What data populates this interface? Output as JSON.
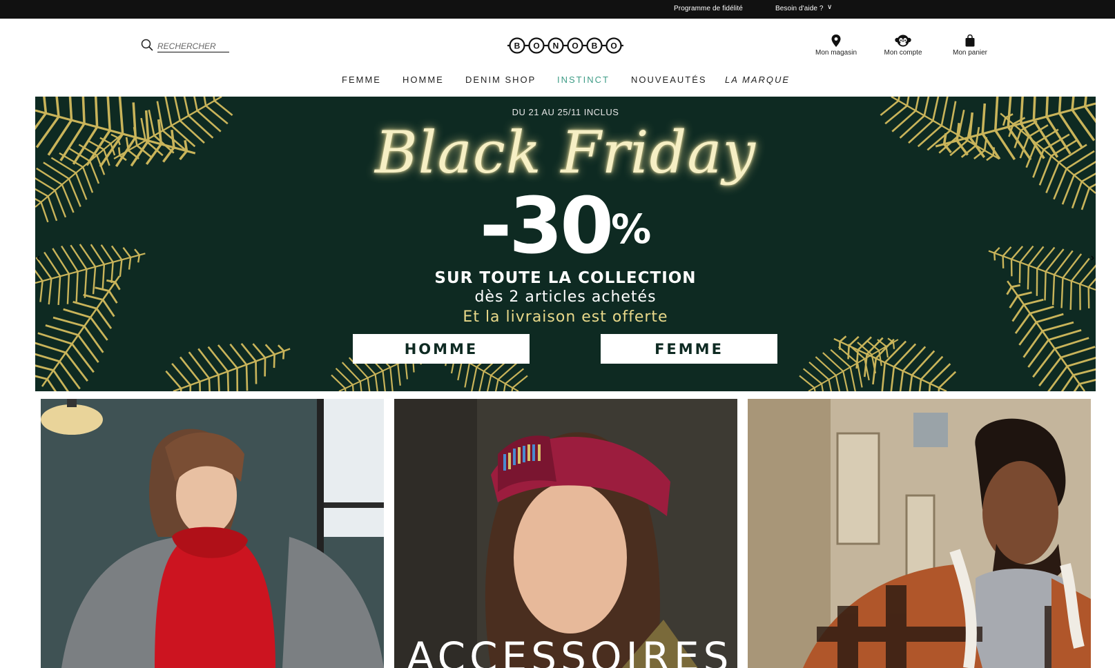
{
  "topbar": {
    "loyalty": "Programme de fidélité",
    "help": "Besoin d'aide ?"
  },
  "search": {
    "placeholder": "RECHERCHER"
  },
  "logo": {
    "letters": [
      "B",
      "O",
      "N",
      "O",
      "B",
      "O"
    ]
  },
  "header_icons": {
    "store": {
      "label": "Mon magasin",
      "icon": "location-pin-icon"
    },
    "account": {
      "label": "Mon compte",
      "icon": "monkey-icon"
    },
    "cart": {
      "label": "Mon panier",
      "icon": "shopping-bag-icon"
    }
  },
  "nav": {
    "items": [
      "FEMME",
      "HOMME",
      "DENIM SHOP",
      "INSTINCT",
      "NOUVEAUTÉS",
      "LA MARQUE"
    ]
  },
  "hero": {
    "dates": "DU 21 AU 25/11 INCLUS",
    "title": "Black Friday",
    "discount": "-30",
    "percent": "%",
    "line1": "SUR TOUTE LA COLLECTION",
    "line2": "dès 2 articles achetés",
    "line3": "Et la livraison est offerte",
    "cta_homme": "HOMME",
    "cta_femme": "FEMME"
  },
  "tiles": [
    {
      "label": ""
    },
    {
      "label": "ACCESSOIRES"
    },
    {
      "label": ""
    }
  ],
  "colors": {
    "topbar": "#111111",
    "hero_bg": "#0e2a22",
    "gold": "#c9b45a",
    "instinct": "#3e9c86"
  }
}
